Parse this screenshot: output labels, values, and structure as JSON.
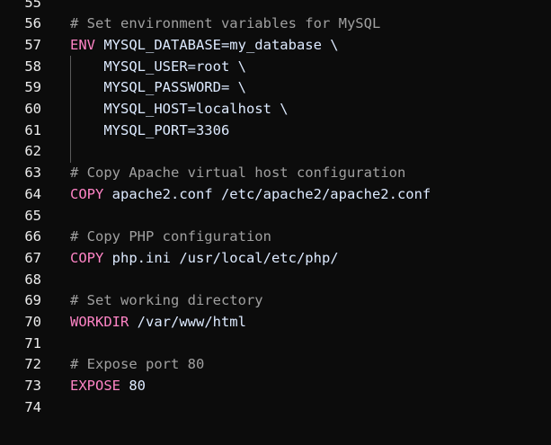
{
  "editor": {
    "lines": [
      {
        "number": "55",
        "keyword": "",
        "text": "",
        "comment": ""
      },
      {
        "number": "56",
        "keyword": "",
        "text": "",
        "comment": "# Set environment variables for MySQL"
      },
      {
        "number": "57",
        "keyword": "ENV",
        "text": " MYSQL_DATABASE=my_database \\",
        "comment": ""
      },
      {
        "number": "58",
        "keyword": "",
        "text": "    MYSQL_USER=root \\",
        "comment": ""
      },
      {
        "number": "59",
        "keyword": "",
        "text": "    MYSQL_PASSWORD= \\",
        "comment": ""
      },
      {
        "number": "60",
        "keyword": "",
        "text": "    MYSQL_HOST=localhost \\",
        "comment": ""
      },
      {
        "number": "61",
        "keyword": "",
        "text": "    MYSQL_PORT=3306",
        "comment": ""
      },
      {
        "number": "62",
        "keyword": "",
        "text": "",
        "comment": ""
      },
      {
        "number": "63",
        "keyword": "",
        "text": "",
        "comment": "# Copy Apache virtual host configuration"
      },
      {
        "number": "64",
        "keyword": "COPY",
        "text": " apache2.conf /etc/apache2/apache2.conf",
        "comment": ""
      },
      {
        "number": "65",
        "keyword": "",
        "text": "",
        "comment": ""
      },
      {
        "number": "66",
        "keyword": "",
        "text": "",
        "comment": "# Copy PHP configuration"
      },
      {
        "number": "67",
        "keyword": "COPY",
        "text": " php.ini /usr/local/etc/php/",
        "comment": ""
      },
      {
        "number": "68",
        "keyword": "",
        "text": "",
        "comment": ""
      },
      {
        "number": "69",
        "keyword": "",
        "text": "",
        "comment": "# Set working directory"
      },
      {
        "number": "70",
        "keyword": "WORKDIR",
        "text": " /var/www/html",
        "comment": ""
      },
      {
        "number": "71",
        "keyword": "",
        "text": "",
        "comment": ""
      },
      {
        "number": "72",
        "keyword": "",
        "text": "",
        "comment": "# Expose port 80"
      },
      {
        "number": "73",
        "keyword": "EXPOSE",
        "text": " 80",
        "comment": ""
      },
      {
        "number": "74",
        "keyword": "",
        "text": "",
        "comment": ""
      }
    ],
    "colors": {
      "background": "#0c0c0c",
      "line_number": "#ececec",
      "comment": "#a0a0a0",
      "keyword": "#ff84c6",
      "text": "#ddeaff"
    }
  }
}
